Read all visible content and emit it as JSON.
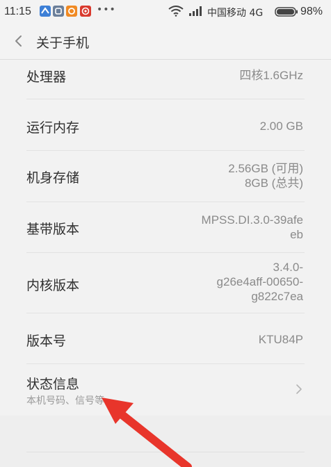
{
  "status_bar": {
    "time": "11:15",
    "more_dots": "•••",
    "carrier": "中国移动 4G",
    "battery": "98%"
  },
  "header": {
    "title": "关于手机"
  },
  "rows": [
    {
      "label": "处理器",
      "value": "四核1.6GHz"
    },
    {
      "label": "运行内存",
      "value": "2.00 GB"
    },
    {
      "label": "机身存储",
      "value_line1": "2.56GB (可用)",
      "value_line2": "8GB (总共)"
    },
    {
      "label": "基带版本",
      "value_line1": "MPSS.DI.3.0-39afe",
      "value_line2": "eb"
    },
    {
      "label": "内核版本",
      "value_line1": "3.4.0-",
      "value_line2": "g26e4aff-00650-",
      "value_line3": "g822c7ea"
    },
    {
      "label": "版本号",
      "value": "KTU84P"
    },
    {
      "label": "状态信息",
      "sublabel": "本机号码、信号等"
    }
  ],
  "colors": {
    "background": "#f2f2f2",
    "annotation_arrow": "#e8352b"
  }
}
